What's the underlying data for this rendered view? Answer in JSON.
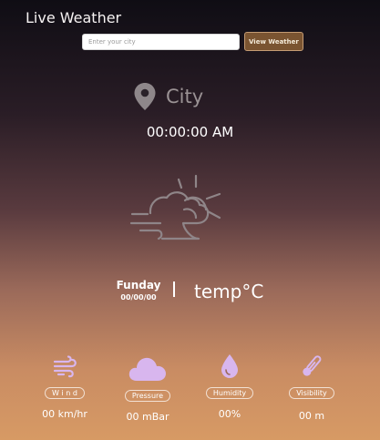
{
  "header": {
    "title": "Live Weather"
  },
  "search": {
    "placeholder": "Enter your city",
    "button_label": "View Weather"
  },
  "location": {
    "city": "City",
    "icon": "map-pin-icon"
  },
  "clock": {
    "time": "00:00:00 AM"
  },
  "current": {
    "condition_icon": "partly-cloudy-windy-icon",
    "day": "Funday",
    "date": "00/00/00",
    "temperature": "temp°C"
  },
  "stats": [
    {
      "icon": "wind-icon",
      "label": "W i n d",
      "value": "00 km/hr"
    },
    {
      "icon": "cloud-icon",
      "label": "Pressure",
      "value": "00 mBar"
    },
    {
      "icon": "water-drop-icon",
      "label": "Humidity",
      "value": "00%"
    },
    {
      "icon": "thermometer-icon",
      "label": "Visibility",
      "value": "00 m"
    }
  ],
  "colors": {
    "icon_accent": "#d8b6ee",
    "button_bg": "#7a5431"
  }
}
